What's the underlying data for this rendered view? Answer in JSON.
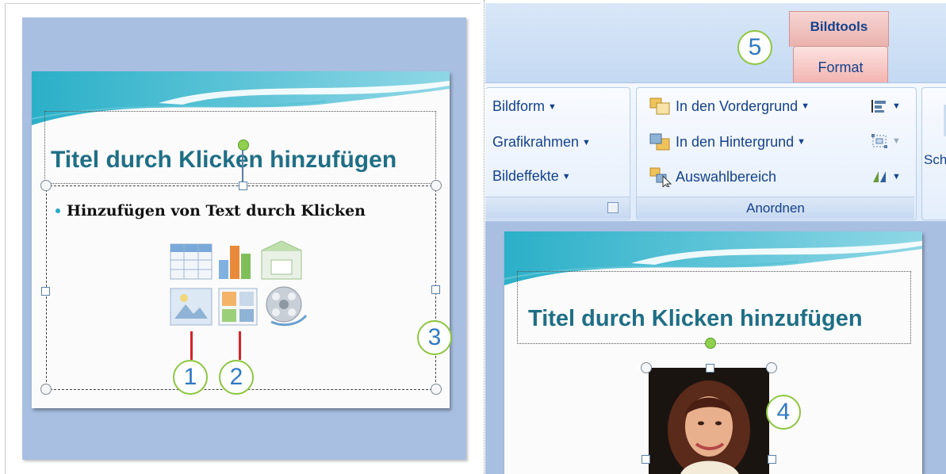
{
  "left_slide": {
    "title": "Titel durch Klicken hinzufügen",
    "bullet": "Hinzufügen von Text durch Klicken",
    "callouts": [
      "1",
      "2",
      "3"
    ]
  },
  "ribbon": {
    "contextual_tab_group": "Bildtools",
    "active_tab": "Format",
    "callout": "5",
    "picture_styles": {
      "items": [
        "Bildform",
        "Grafikrahmen",
        "Bildeffekte"
      ]
    },
    "arrange": {
      "label": "Anordnen",
      "items": [
        "In den Vordergrund",
        "In den Hintergrund",
        "Auswahlbereich"
      ]
    },
    "next_group_partial": "Sch"
  },
  "right_slide": {
    "title": "Titel durch Klicken hinzufügen",
    "callout": "4"
  },
  "colors": {
    "title": "#1f6f86",
    "callout_border": "#8dc63f",
    "callout_text": "#2f78c4",
    "ribbon_text": "#15428b",
    "tab_active": "#f3b3b0"
  },
  "icons": [
    "table-icon",
    "chart-icon",
    "smartart-icon",
    "picture-icon",
    "clipart-icon",
    "media-icon"
  ]
}
